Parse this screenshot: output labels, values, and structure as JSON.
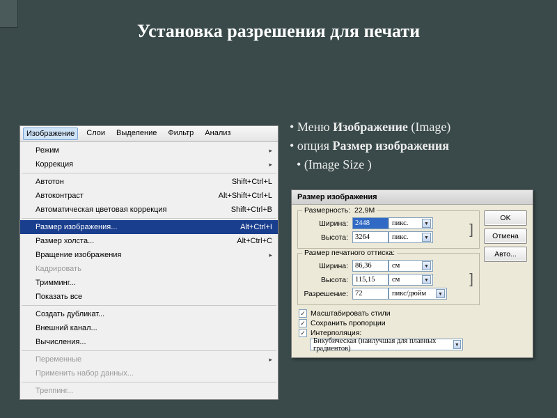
{
  "title": "Установка разрешения для печати",
  "menubar": [
    "Изображение",
    "Слои",
    "Выделение",
    "Фильтр",
    "Анализ"
  ],
  "menu": {
    "items": [
      {
        "label": "Режим",
        "sub": true
      },
      {
        "label": "Коррекция",
        "sub": true
      },
      {
        "sep": true
      },
      {
        "label": "Автотон",
        "shortcut": "Shift+Ctrl+L"
      },
      {
        "label": "Автоконтраст",
        "shortcut": "Alt+Shift+Ctrl+L"
      },
      {
        "label": "Автоматическая цветовая коррекция",
        "shortcut": "Shift+Ctrl+B"
      },
      {
        "sep": true
      },
      {
        "label": "Размер изображения...",
        "shortcut": "Alt+Ctrl+I",
        "hi": true
      },
      {
        "label": "Размер холста...",
        "shortcut": "Alt+Ctrl+C"
      },
      {
        "label": "Вращение изображения",
        "sub": true
      },
      {
        "label": "Кадрировать",
        "dis": true
      },
      {
        "label": "Тримминг..."
      },
      {
        "label": "Показать все"
      },
      {
        "sep": true
      },
      {
        "label": "Создать дубликат..."
      },
      {
        "label": "Внешний канал..."
      },
      {
        "label": "Вычисления..."
      },
      {
        "sep": true
      },
      {
        "label": "Переменные",
        "sub": true,
        "dis": true
      },
      {
        "label": "Применить набор данных...",
        "dis": true
      },
      {
        "sep": true
      },
      {
        "label": "Треппинг...",
        "dis": true
      }
    ]
  },
  "bullets": [
    {
      "pre": "Меню ",
      "bold": "Изображение",
      "post": " (Image)"
    },
    {
      "pre": " опция ",
      "bold": "Размер изображения",
      "post": ""
    },
    {
      "pre": "  (Image Size )",
      "bold": "",
      "post": ""
    }
  ],
  "dialog": {
    "title": "Размер изображения",
    "buttons": {
      "ok": "OK",
      "cancel": "Отмена",
      "auto": "Авто..."
    },
    "pixDim": {
      "group": "Размерность:",
      "size": "22,9M",
      "widthLabel": "Ширина:",
      "width": "2448",
      "heightLabel": "Высота:",
      "height": "3264",
      "unit": "пикс."
    },
    "docSize": {
      "group": "Размер печатного оттиска:",
      "widthLabel": "Ширина:",
      "width": "86,36",
      "heightLabel": "Высота:",
      "height": "115,15",
      "unit": "см",
      "resLabel": "Разрешение:",
      "res": "72",
      "resUnit": "пикс/дюйм"
    },
    "checks": {
      "scale": "Масштабировать стили",
      "constrain": "Сохранить пропорции",
      "resample": "Интерполяция:"
    },
    "interp": "Бикубическая (наилучшая для плавных градиентов)"
  }
}
